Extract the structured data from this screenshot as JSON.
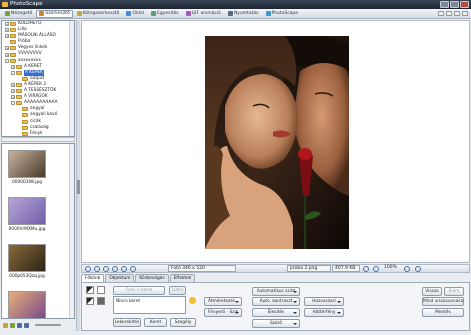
{
  "app": {
    "title": "PhotoScape"
  },
  "tabs": [
    {
      "label": "Nézegető"
    },
    {
      "label": "Szerkesztő"
    },
    {
      "label": "Kötegszerkesztő"
    },
    {
      "label": "Oldal"
    },
    {
      "label": "Egyesítés"
    },
    {
      "label": "GIF animáció"
    },
    {
      "label": "Nyomtatás"
    },
    {
      "label": "PhotoScape"
    }
  ],
  "tree": [
    {
      "label": "KÜLDHETŐ",
      "indent": 1,
      "expander": "+",
      "selected": false
    },
    {
      "label": "Lilla",
      "indent": 1,
      "expander": "+",
      "selected": false
    },
    {
      "label": "MÁSOLNI ÁLLÁSO",
      "indent": 1,
      "expander": "+",
      "selected": false
    },
    {
      "label": "Próba",
      "indent": 1,
      "expander": "",
      "selected": false
    },
    {
      "label": "Vegyes linkek",
      "indent": 1,
      "expander": "+",
      "selected": false
    },
    {
      "label": "VVVVVVVV",
      "indent": 1,
      "expander": "+",
      "selected": false
    },
    {
      "label": "xxxxxxxxx",
      "indent": 1,
      "expander": "-",
      "selected": false
    },
    {
      "label": "A KERET",
      "indent": 2,
      "expander": "+",
      "selected": false
    },
    {
      "label": "A KÉPEK",
      "indent": 2,
      "expander": "-",
      "selected": true
    },
    {
      "label": "output",
      "indent": 3,
      "expander": "",
      "selected": false
    },
    {
      "label": "A KÉPEK 2",
      "indent": 2,
      "expander": "+",
      "selected": false
    },
    {
      "label": "A TESSÉSZTŐK",
      "indent": 2,
      "expander": "+",
      "selected": false
    },
    {
      "label": "A VIRÁGOK",
      "indent": 2,
      "expander": "+",
      "selected": false
    },
    {
      "label": "AAAAAAAAAAA",
      "indent": 2,
      "expander": "-",
      "selected": false
    },
    {
      "label": "angyal",
      "indent": 3,
      "expander": "",
      "selected": false
    },
    {
      "label": "angyali kávé",
      "indent": 3,
      "expander": "",
      "selected": false
    },
    {
      "label": "cicák",
      "indent": 3,
      "expander": "",
      "selected": false
    },
    {
      "label": "csaláság",
      "indent": 3,
      "expander": "",
      "selected": false
    },
    {
      "label": "Fényk",
      "indent": 3,
      "expander": "",
      "selected": false
    }
  ],
  "thumbnails": [
    {
      "caption": "00000308.jpg",
      "color_a": "#c8b49c",
      "color_b": "#4a3a2e"
    },
    {
      "caption": "0000VrMXMu.jpg",
      "color_a": "#b7a6d8",
      "color_b": "#6f5fa8"
    },
    {
      "caption": "000p053Qzq.jpg",
      "color_a": "#8a6a3a",
      "color_b": "#2c2418"
    },
    {
      "caption": "",
      "color_a": "#e8b07a",
      "color_b": "#7a4a8a"
    }
  ],
  "status": {
    "dimensions": "Fotó 346 x 520",
    "filename": "proba 2.png",
    "filesize": "407.9 KB",
    "zoom": "100%"
  },
  "editor_tabs": [
    {
      "label": "Főkönb"
    },
    {
      "label": "Objektum"
    },
    {
      "label": "Körbevágás"
    },
    {
      "label": "Effektek"
    }
  ],
  "tools": {
    "frame_size_label": "Fotó + keret",
    "frame_size_percent": "100%",
    "frame_select": "Nincs keret",
    "lekerekites": "Lekerekítés",
    "keret": "Keret",
    "szegely": "Szegély",
    "atmeretezes": "Átméretezés",
    "fenyero_szin": "Fényerő - Szín",
    "automatikus_szint": "Automatikus szint",
    "auto_kontraszt": "Auto. kontraszt",
    "elesites": "Élesítés",
    "szuro": "Szűrő",
    "hozvarazsitas": "Hozvarázsl",
    "hattervilagitas": "Háttérfény",
    "vissza": "Vissza",
    "elore": "Előre",
    "mind_visszavonasa": "Mind visszavonása",
    "mentes": "Mentés"
  }
}
